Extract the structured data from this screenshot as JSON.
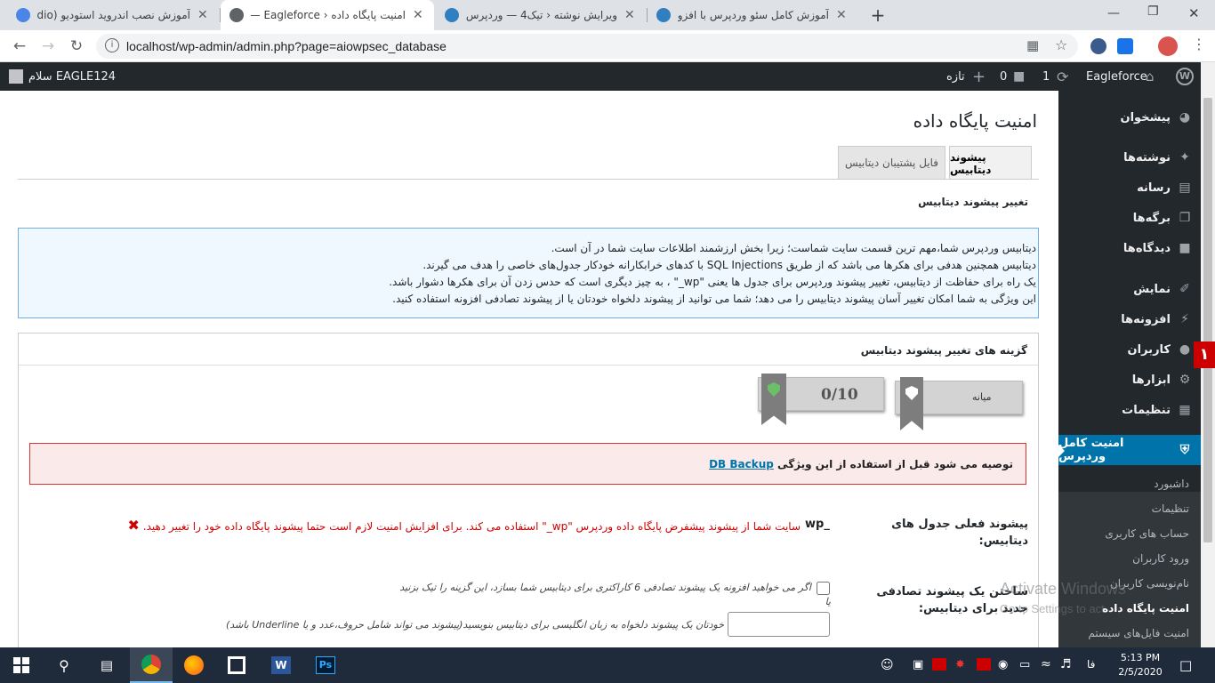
{
  "browser": {
    "tabs": [
      {
        "label": "آموزش نصب اندروید استودیو (Android Studio)",
        "active": false
      },
      {
        "label": "امنیت پایگاه داده ‹ Eagleforce — وردپرس",
        "active": true
      },
      {
        "label": "ویرایش نوشته ‹ تیک4 — وردپرس",
        "active": false
      },
      {
        "label": "آموزش کامل سئو وردپرس با افزونه",
        "active": false
      }
    ],
    "url": "localhost/wp-admin/admin.php?page=aiowpsec_database",
    "new_tab": "+",
    "close": "✕"
  },
  "adminbar": {
    "site_name": "Eagleforce",
    "updates_count": "1",
    "comments_count": "0",
    "new_label": "تازه",
    "greeting": "سلام EAGLE124"
  },
  "menu": {
    "items": [
      {
        "label": "پیشخوان",
        "icon": "dashboard-icon"
      },
      {
        "label": "نوشته‌ها",
        "icon": "pin-icon"
      },
      {
        "label": "رسانه",
        "icon": "media-icon"
      },
      {
        "label": "برگه‌ها",
        "icon": "pages-icon"
      },
      {
        "label": "دیدگاه‌ها",
        "icon": "comment-icon"
      },
      {
        "label": "نمایش",
        "icon": "brush-icon"
      },
      {
        "label": "افزونه‌ها",
        "icon": "plugin-icon"
      },
      {
        "label": "کاربران",
        "icon": "user-icon"
      },
      {
        "label": "ابزارها",
        "icon": "wrench-icon"
      },
      {
        "label": "تنظیمات",
        "icon": "settings-icon"
      }
    ],
    "current": "امنیت کامل وردپرس",
    "submenu": [
      "داشبورد",
      "تنظیمات",
      "حساب های کاربری",
      "ورود کاربران",
      "نام‌نویسی کاربران",
      "امنیت پایگاه داده",
      "امنیت فایل‌های سیستم"
    ],
    "badge": "۱"
  },
  "page": {
    "title": "امنیت پایگاه داده",
    "tabs": [
      "پیشوند دیتابیس",
      "فایل پشتیبان دیتابیس"
    ],
    "section_title": "تغییر پیشوند دیتابیس",
    "info_lines": [
      "دیتابیس وردپرس شما،مهم ترین قسمت سایت شماست؛ زیرا بخش ارزشمند اطلاعات سایت شما در آن است.",
      "دیتابیس همچنین هدفی برای هکرها می باشد که از طریق SQL Injections با کدهای خرابکارانه خودکار جدول‌های خاصی را هدف می گیرند.",
      "یک راه برای حفاظت از دیتابیس، تغییر پیشوند وردپرس برای جدول ها یعنی \"wp_\" ، به چیز دیگری است که حدس زدن آن برای هکرها دشوار باشد.",
      "این ویژگی به شما امکان تغییر آسان پیشوند دیتابیس را می دهد؛ شما می توانید از پیشوند دلخواه خودتان یا از پیشوند تصادفی افزونه استفاده کنید."
    ],
    "options_title": "گزینه های تغییر پیشوند دیتابیس",
    "badge_level": "میانه",
    "badge_score": "0/10",
    "warning_text": "توصیه می شود قبل از استفاده از این ویژگی",
    "warning_link": "DB Backup",
    "current_prefix_label": "پیشوند فعلی جدول های دیتابیس:",
    "current_prefix_value": "wp_",
    "current_prefix_note": "سایت شما از پیشوند پیشفرض پایگاه داده وردپرس \"wp_\" استفاده می کند. برای افزایش امنیت لازم است حتما پیشوند پایگاه داده خود را تغییر دهید.",
    "random_prefix_label": "ساختن یک پیشوند تصادفی جدید برای دیتابیس:",
    "random_checkbox_text": "اگر می خواهید افزونه یک پیشوند تصادفی 6 کاراکتری برای دیتابیس شما بسازد، این گزینه را تیک بزنید",
    "or_text": "یا",
    "custom_prefix_text": "خودتان یک پیشوند دلخواه به زبان انگلیسی برای دیتابیس بنویسید(پیشوند می تواند شامل حروف،عدد و یا Underline باشد)",
    "activate_title": "Activate Windows",
    "activate_sub": "Go to Settings to activate Windows."
  },
  "taskbar": {
    "time": "5:13 PM",
    "date": "2/5/2020",
    "lang": "فا"
  },
  "colors": {
    "admin_bar": "#23282d",
    "accent": "#0073aa",
    "info_bg": "#f0f8ff",
    "warning_bg": "#fbeaea",
    "warning_border": "#dc3232",
    "error_text": "#d00000"
  }
}
